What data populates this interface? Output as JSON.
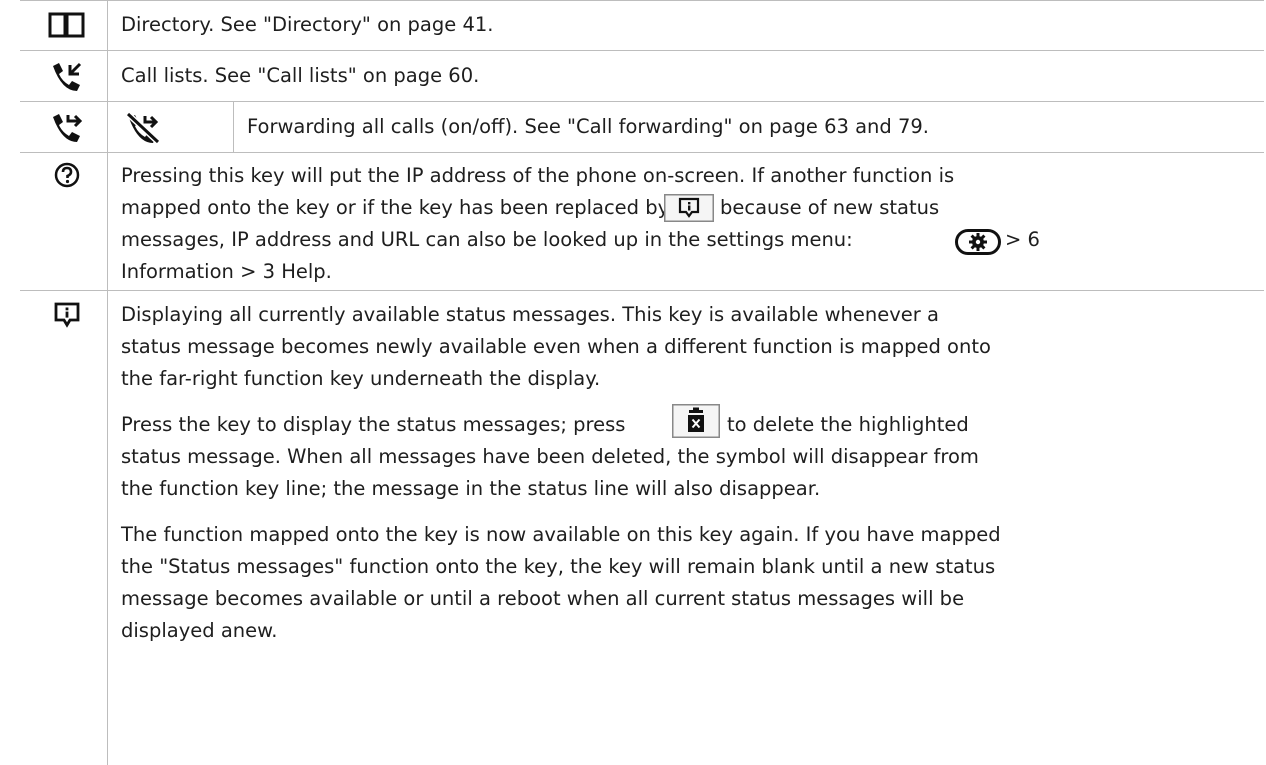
{
  "rows": [
    {
      "icon": "book-icon",
      "text": "Directory.  See \"Directory\" on page 41."
    },
    {
      "icon": "call-list-icon",
      "text": "Call lists.  See \"Call lists\" on page 60."
    },
    {
      "icon_on": "call-forward-icon",
      "icon_off": "call-forward-off-icon",
      "text": "Forwarding all calls (on/off).  See \"Call forwarding\" on page 63 and 79."
    },
    {
      "icon": "help-icon",
      "line1": "Pressing this key will put the IP address of the phone on-screen.  If another function is",
      "line2a": "mapped onto the key or if the key has been replaced by",
      "line2b": "because of new status",
      "line3a": "messages, IP address and URL can also be looked up in the settings menu:",
      "line3b": "> 6",
      "line4": "Information > 3 Help."
    },
    {
      "icon": "status-message-icon",
      "p1": [
        "Displaying all currently available status messages.  This key is available whenever a",
        "status message becomes newly available even when a different function is mapped onto",
        "the far-right function key underneath the display."
      ],
      "p2_line1a": "Press the key to display the status messages;  press",
      "p2_line1b": "to delete the highlighted",
      "p2_rest": [
        "status message.  When all messages have been deleted, the symbol will disappear from",
        "the function key line; the message in the status line will also disappear."
      ],
      "p3": [
        "The function mapped onto the key is now available on this key again.  If you have mapped",
        "the \"Status messages\" function onto the key, the key will remain blank until a new status",
        "message becomes available or until a reboot when all current status messages will be",
        "displayed anew."
      ]
    }
  ]
}
